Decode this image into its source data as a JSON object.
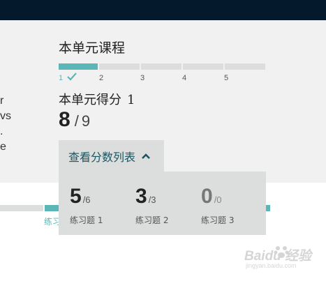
{
  "unit": {
    "lesson_title": "本单元课程",
    "steps": [
      {
        "label": "1",
        "done": true
      },
      {
        "label": "2",
        "done": false
      },
      {
        "label": "3",
        "done": false
      },
      {
        "label": "4",
        "done": false
      },
      {
        "label": "5",
        "done": false
      }
    ],
    "score_title": "本单元得分",
    "score_title_num": "1",
    "score": "8",
    "score_total": "9"
  },
  "left_snippet": [
    "r",
    "vs",
    ".",
    "e"
  ],
  "score_toggle": {
    "label": "查看分数列表",
    "icon": "chevron-up-icon"
  },
  "score_list": [
    {
      "value": "5",
      "total": "/6",
      "name": "练习题 1"
    },
    {
      "value": "3",
      "total": "/3",
      "name": "练习题 2"
    },
    {
      "value": "0",
      "total": "/0",
      "name": "练习题 3"
    }
  ],
  "below": {
    "label": "练习"
  },
  "watermark": {
    "brand": "Baidu 经验",
    "url": "jingyan.baidu.com"
  },
  "colors": {
    "accent": "#5bb7b7",
    "topbar": "#04192b",
    "panel": "#f1f1f1",
    "button": "#dcdedd",
    "link": "#1b5660"
  }
}
